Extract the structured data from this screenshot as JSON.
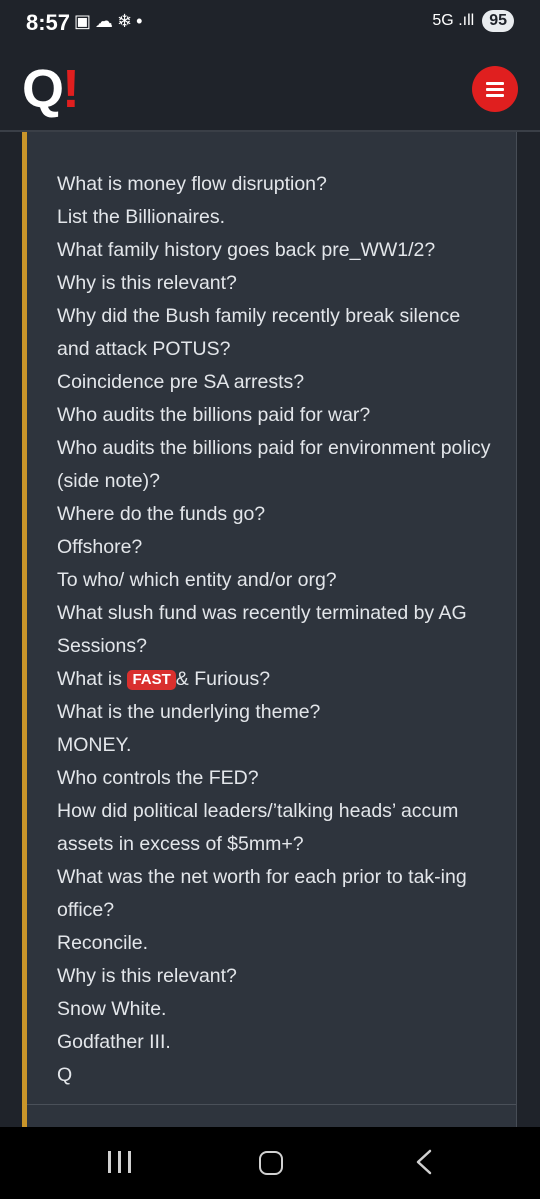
{
  "status_bar": {
    "time": "8:57",
    "left_icons": "▣☁❄•",
    "signal": "5G .ıll",
    "battery": "95"
  },
  "header": {
    "logo_letter": "Q",
    "logo_mark": "!",
    "menu_icon": "hamburger-icon",
    "accent_color": "#e01f1f"
  },
  "post": {
    "border_color": "#c9952a",
    "lines": [
      "What is money flow disruption?",
      "List the Billionaires.",
      "What family history goes back pre_WW1/2?",
      "Why is this relevant?",
      "Why did the Bush family recently break silence and attack POTUS?",
      "Coincidence pre SA arrests?",
      "Who audits the billions paid for war?",
      "Who audits the billions paid for environment policy (side note)?",
      "Where do the funds go?",
      "Offshore?",
      "To who/ which entity and/or org?",
      "What slush fund was recently terminated by AG Sessions?",
      "What is",
      "What is the underlying theme?",
      "MONEY.",
      "Who controls the FED?",
      "How did political leaders/’talking heads’ accum assets in excess of $5mm+?",
      "What was the net worth for each prior to tak-ing office?",
      "Reconcile.",
      "Why is this relevant?",
      "Snow White.",
      "Godfather III.",
      "Q"
    ],
    "fast_badge": "FAST",
    "fast_suffix": "& Furious?"
  },
  "nav_bar": {
    "recent_icon": "recent-apps-icon",
    "home_icon": "home-icon",
    "back_icon": "back-icon"
  }
}
